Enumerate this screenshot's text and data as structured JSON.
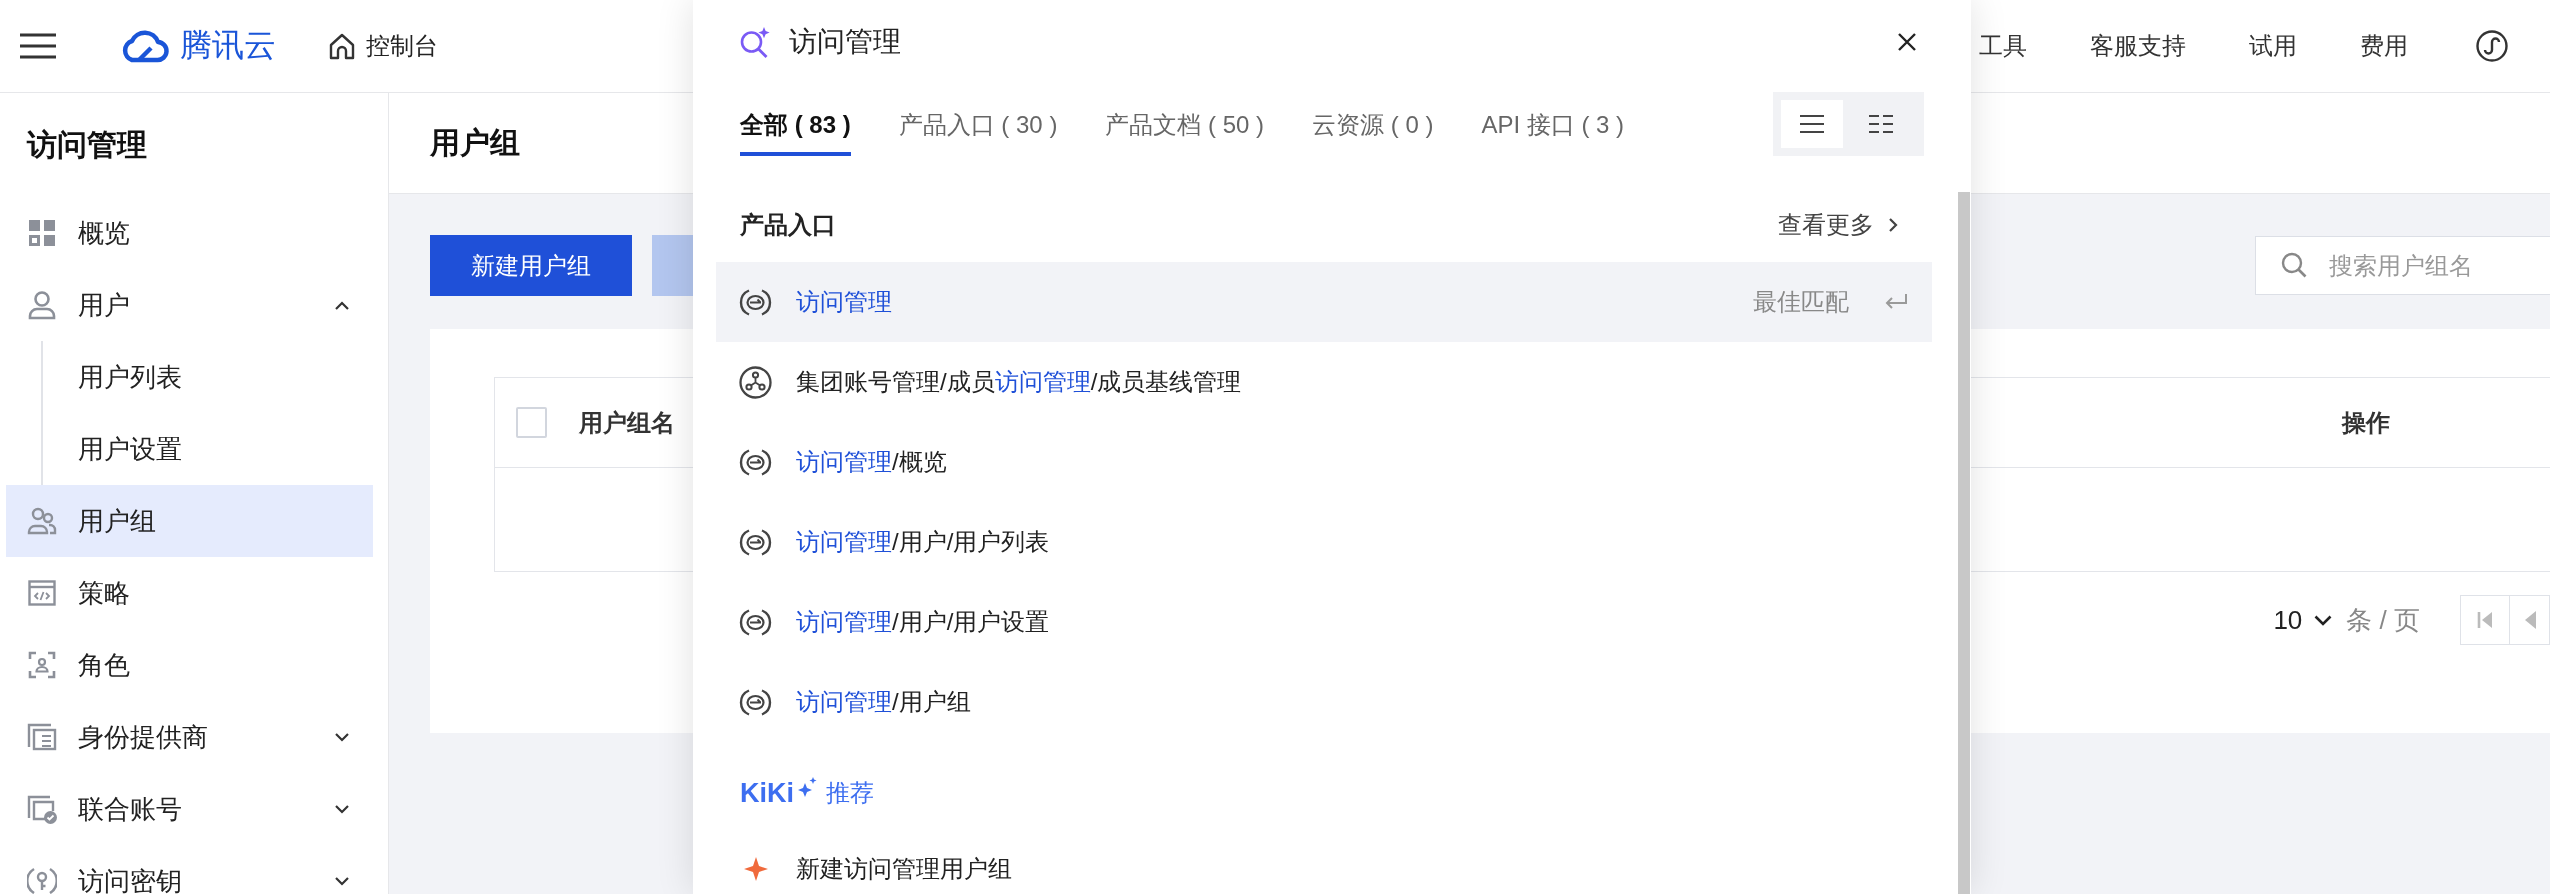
{
  "header": {
    "logo": "腾讯云",
    "console": "控制台",
    "links": [
      "工具",
      "客服支持",
      "试用",
      "费用"
    ]
  },
  "sidebar": {
    "title": "访问管理",
    "items": [
      {
        "label": "概览",
        "selected": false
      },
      {
        "label": "用户",
        "selected": false,
        "expanded": true,
        "children": [
          {
            "label": "用户列表",
            "selected": false
          },
          {
            "label": "用户设置",
            "selected": false
          }
        ]
      },
      {
        "label": "用户组",
        "selected": true
      },
      {
        "label": "策略",
        "selected": false
      },
      {
        "label": "角色",
        "selected": false
      },
      {
        "label": "身份提供商",
        "selected": false,
        "expanded": false
      },
      {
        "label": "联合账号",
        "selected": false,
        "expanded": false
      },
      {
        "label": "访问密钥",
        "selected": false,
        "expanded": false
      }
    ]
  },
  "page": {
    "title": "用户组",
    "buttons": [
      {
        "kind": "primary",
        "label": "新建用户组"
      },
      {
        "kind": "secondary"
      }
    ],
    "search": {
      "placeholder": "搜索用户组名"
    },
    "table": {
      "select_all": {
        "checked": false
      },
      "columns": [
        {
          "label": "用户组名"
        },
        {
          "label": "操作"
        }
      ]
    },
    "pagination": {
      "page_size": "10",
      "unit": "条 / 页"
    }
  },
  "search_panel": {
    "query": "访问管理",
    "tabs": [
      {
        "label": "全部 ( 83 )",
        "selected": true
      },
      {
        "label": "产品入口 ( 30 )",
        "selected": false
      },
      {
        "label": "产品文档 ( 50 )",
        "selected": false
      },
      {
        "label": "云资源 ( 0 )",
        "selected": false
      },
      {
        "label": "API 接口 ( 3 )",
        "selected": false
      }
    ],
    "view_modes": [
      {
        "kind": "list",
        "selected": true
      },
      {
        "kind": "detail",
        "selected": false
      }
    ],
    "section": {
      "title": "产品入口",
      "more": "查看更多"
    },
    "results": [
      {
        "kind": "product",
        "selected": true,
        "segments": [
          {
            "text": "访问管理",
            "match": true
          }
        ],
        "badge": "最佳匹配"
      },
      {
        "kind": "organization",
        "selected": false,
        "segments": [
          {
            "text": "集团账号管理/成员",
            "match": false
          },
          {
            "text": "访问管理",
            "match": true
          },
          {
            "text": "/成员基线管理",
            "match": false
          }
        ]
      },
      {
        "kind": "product",
        "selected": false,
        "segments": [
          {
            "text": "访问管理",
            "match": true
          },
          {
            "text": "/概览",
            "match": false
          }
        ]
      },
      {
        "kind": "product",
        "selected": false,
        "segments": [
          {
            "text": "访问管理",
            "match": true
          },
          {
            "text": "/用户/用户列表",
            "match": false
          }
        ]
      },
      {
        "kind": "product",
        "selected": false,
        "segments": [
          {
            "text": "访问管理",
            "match": true
          },
          {
            "text": "/用户/用户设置",
            "match": false
          }
        ]
      },
      {
        "kind": "product",
        "selected": false,
        "segments": [
          {
            "text": "访问管理",
            "match": true
          },
          {
            "text": "/用户组",
            "match": false
          }
        ]
      }
    ],
    "kiki": {
      "brand": "KiKi",
      "label": "推荐"
    },
    "suggestions": [
      {
        "label": "新建访问管理用户组"
      }
    ]
  }
}
